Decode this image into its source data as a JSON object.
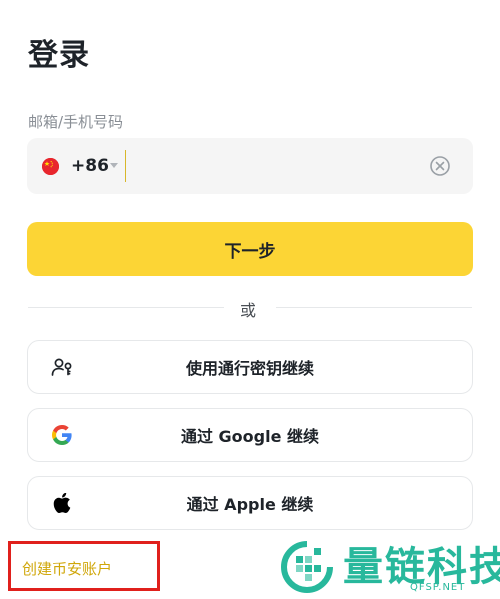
{
  "page": {
    "title": "登录"
  },
  "login_form": {
    "field_label": "邮箱/手机号码",
    "country_flag": "china-flag-icon",
    "country_code": "+86",
    "phone_value": "",
    "next_label": "下一步"
  },
  "divider": {
    "text": "或"
  },
  "alt_options": {
    "passkey_label": "使用通行密钥继续",
    "google_label": "通过 Google 继续",
    "apple_label": "通过 Apple 继续"
  },
  "footer": {
    "create_account": "创建币安账户"
  },
  "watermark": {
    "name": "量链科技",
    "site": "QFSP.NET"
  },
  "colors": {
    "primary_yellow": "#fcd535",
    "text_dark": "#1e2329",
    "link_gold": "#d0a70a",
    "highlight_red": "#e0201c",
    "watermark_green": "#28b89c"
  }
}
